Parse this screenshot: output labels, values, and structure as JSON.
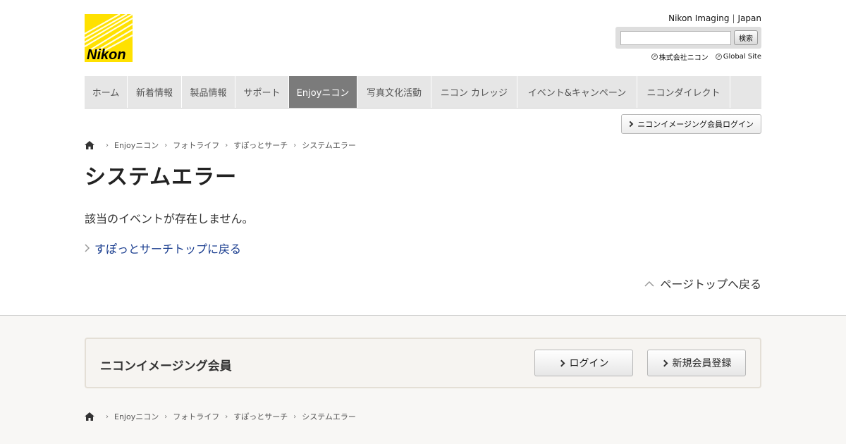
{
  "header": {
    "logo_text": "Nikon",
    "site_name": "Nikon Imaging",
    "region": "Japan",
    "search": {
      "placeholder": "",
      "button_label": "検索"
    },
    "links": [
      {
        "label": "株式会社ニコン"
      },
      {
        "label": "Global Site"
      }
    ]
  },
  "nav": {
    "items": [
      {
        "label": "ホーム",
        "active": false
      },
      {
        "label": "新着情報",
        "active": false
      },
      {
        "label": "製品情報",
        "active": false
      },
      {
        "label": "サポート",
        "active": false
      },
      {
        "label": "Enjoyニコン",
        "active": true
      },
      {
        "label": "写真文化活動",
        "active": false
      },
      {
        "label": "ニコン カレッジ",
        "active": false
      },
      {
        "label": "イベント&キャンペーン",
        "active": false
      },
      {
        "label": "ニコンダイレクト",
        "active": false
      }
    ]
  },
  "login_button": "ニコンイメージング会員ログイン",
  "breadcrumb": [
    "Enjoyニコン",
    "フォトライフ",
    "すぽっとサーチ",
    "システムエラー"
  ],
  "main": {
    "title": "システムエラー",
    "message": "該当のイベントが存在しません。",
    "back_link": "すぽっとサーチトップに戻る",
    "page_top": "ページトップへ戻る"
  },
  "footer": {
    "member_title": "ニコンイメージング会員",
    "login_label": "ログイン",
    "register_label": "新規会員登録"
  },
  "colors": {
    "logo_yellow": "#ffe100",
    "nav_active": "#7b7b7b",
    "link_blue": "#1a3d8f"
  }
}
